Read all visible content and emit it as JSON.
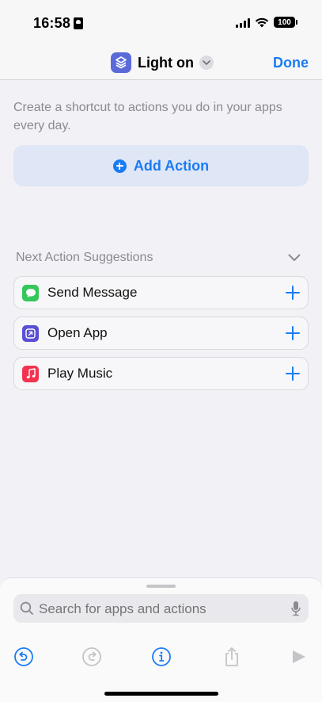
{
  "status": {
    "time": "16:58",
    "battery": "100"
  },
  "nav": {
    "title": "Light on",
    "done": "Done"
  },
  "description": "Create a shortcut to actions you do in your apps every day.",
  "add_action": "Add Action",
  "suggestions": {
    "header": "Next Action Suggestions",
    "items": [
      {
        "label": "Send Message",
        "icon": "messages-icon",
        "color": "#34c759"
      },
      {
        "label": "Open App",
        "icon": "open-app-icon",
        "color": "#5b4fd6"
      },
      {
        "label": "Play Music",
        "icon": "music-icon",
        "color": "#f5334f"
      }
    ]
  },
  "search": {
    "placeholder": "Search for apps and actions"
  },
  "toolbar": {
    "icons": [
      "undo-icon",
      "redo-icon",
      "info-icon",
      "share-icon",
      "play-icon"
    ]
  },
  "colors": {
    "accent": "#1a7cf4",
    "background": "#f2f1f6"
  }
}
